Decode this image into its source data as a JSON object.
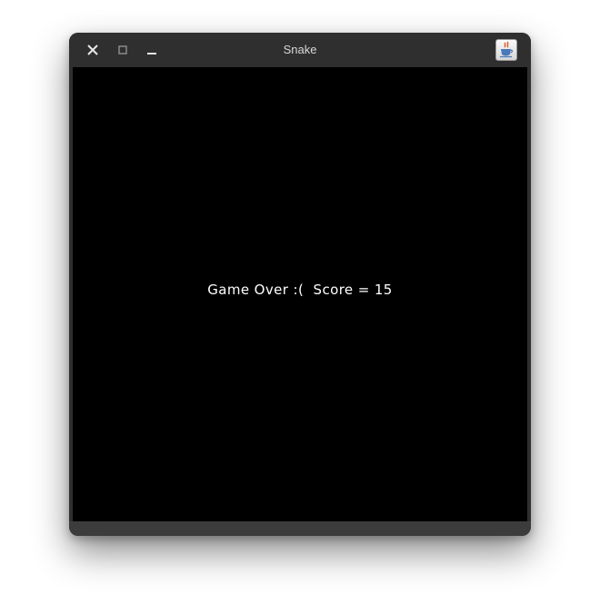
{
  "window": {
    "title": "Snake",
    "controls": [
      "close-icon",
      "maximize-icon",
      "minimize-icon"
    ],
    "app_icon": "java-cup-icon"
  },
  "game": {
    "message": "Game Over :(  Score = 15",
    "background_color": "#000000",
    "text_color": "#ffffff"
  }
}
